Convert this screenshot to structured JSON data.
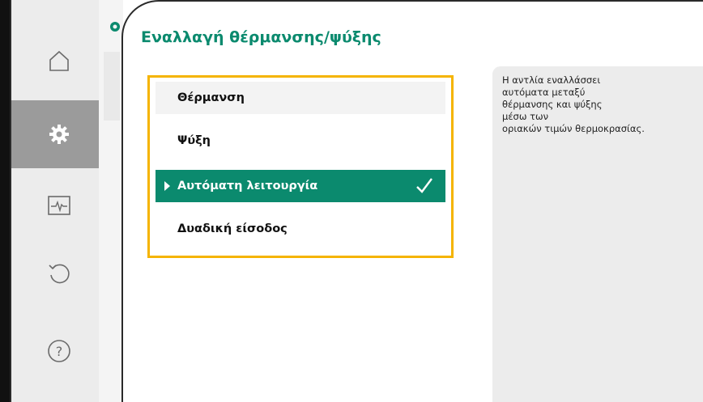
{
  "header": {
    "title": "Εναλλαγή θέρμανσης/ψύξης"
  },
  "sidebar": {
    "items": [
      {
        "icon": "home-icon",
        "active": false
      },
      {
        "icon": "gear-icon",
        "active": true
      },
      {
        "icon": "diagnostics-icon",
        "active": false
      },
      {
        "icon": "undo-icon",
        "active": false
      },
      {
        "icon": "help-icon",
        "active": false
      }
    ]
  },
  "options": [
    {
      "label": "Θέρμανση",
      "selected": false
    },
    {
      "label": "Ψύξη",
      "selected": false
    },
    {
      "label": "Αυτόματη λειτουργία",
      "selected": true
    },
    {
      "label": "Δυαδική είσοδος",
      "selected": false
    }
  ],
  "help": {
    "lines": [
      "Η αντλία εναλλάσσει",
      "αυτόματα μεταξύ",
      "θέρμανσης και ψύξης",
      "μέσω των",
      "οριακών τιμών θερμοκρασίας."
    ]
  },
  "colors": {
    "accent": "#0b8a6e",
    "focus_border": "#f5b400",
    "sidebar_active": "#9b9b9b"
  }
}
